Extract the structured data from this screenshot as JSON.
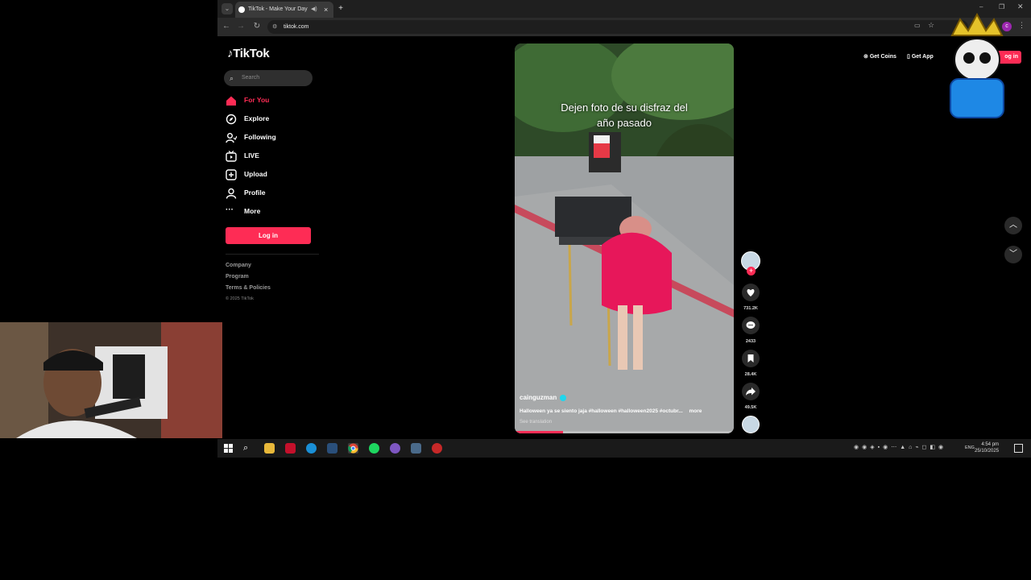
{
  "browser": {
    "tab_title": "TikTok - Make Your Day",
    "url": "tiktok.com",
    "new_tab_glyph": "+",
    "close_tab_glyph": "×"
  },
  "tiktok": {
    "logo_text": "TikTok",
    "search_placeholder": "Search",
    "nav": [
      {
        "label": "For You",
        "icon": "home-icon",
        "active": true
      },
      {
        "label": "Explore",
        "icon": "compass-icon"
      },
      {
        "label": "Following",
        "icon": "following-icon"
      },
      {
        "label": "LIVE",
        "icon": "live-icon"
      },
      {
        "label": "Upload",
        "icon": "upload-icon"
      },
      {
        "label": "Profile",
        "icon": "profile-icon"
      },
      {
        "label": "More",
        "icon": "more-icon"
      }
    ],
    "login_label": "Log in",
    "footer": {
      "company": "Company",
      "program": "Program",
      "terms": "Terms & Policies",
      "copyright": "© 2025 TikTok"
    },
    "top_right": {
      "get_coins": "Get Coins",
      "get_app": "Get App",
      "login_partial": "og in"
    },
    "video": {
      "overlay_caption_line1": "Dejen foto de su disfraz del",
      "overlay_caption_line2": "año pasado",
      "username": "cainguzman",
      "description": "Halloween ya se siento jaja #halloween #halloween2025 #octubr...",
      "more_label": "more",
      "see_translation": "See translation",
      "progress": 0.22
    },
    "actions": {
      "likes": "731.2K",
      "comments": "2433",
      "saves": "28.4K",
      "shares": "49.5K"
    }
  },
  "taskbar": {
    "language": "ENG",
    "time": "4:54 pm",
    "date": "25/10/2025"
  },
  "colors": {
    "accent": "#fe2c55",
    "background": "#000000",
    "tabbar": "#1f1f1f"
  }
}
